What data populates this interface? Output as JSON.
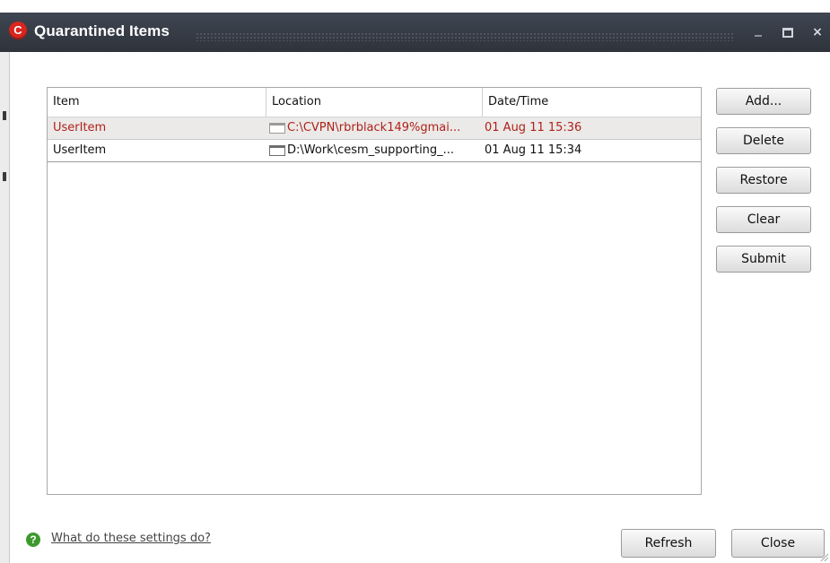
{
  "window": {
    "title": "Quarantined Items",
    "icon_letter": "C",
    "controls": {
      "minimize": "–",
      "maximize": "□",
      "close": "×"
    }
  },
  "table": {
    "columns": [
      "Item",
      "Location",
      "Date/Time"
    ],
    "rows": [
      {
        "item": "UserItem",
        "location": "C:\\CVPN\\rbrblack149%gmai...",
        "datetime": "01 Aug 11 15:36",
        "selected": true
      },
      {
        "item": "UserItem",
        "location": "D:\\Work\\cesm_supporting_...",
        "datetime": "01 Aug 11 15:34",
        "selected": false
      }
    ]
  },
  "actions": {
    "add": "Add...",
    "delete": "Delete",
    "restore": "Restore",
    "clear": "Clear",
    "submit": "Submit"
  },
  "footer": {
    "help_text": "What do these settings do?",
    "refresh": "Refresh",
    "close": "Close"
  },
  "colors": {
    "titlebar": "#2e333b",
    "app_icon": "#d9251d",
    "selected_row_text": "#b0211b",
    "help_icon": "#3c9a2d"
  }
}
